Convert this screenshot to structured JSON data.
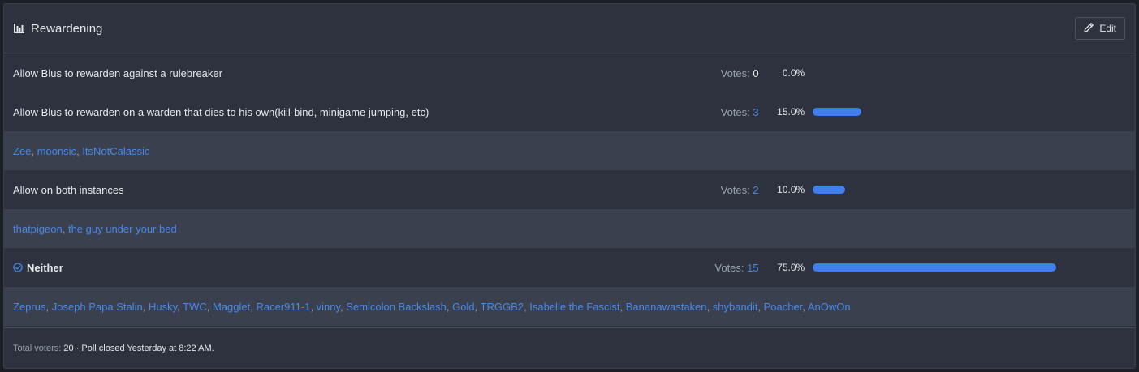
{
  "poll": {
    "title": "Rewardening",
    "edit_label": "Edit",
    "votes_label": "Votes:",
    "options": [
      {
        "label": "Allow Blus to rewarden against a rulebreaker",
        "votes": "0",
        "percent": "0.0%",
        "fraction": 0.0,
        "voters": [],
        "winner": false
      },
      {
        "label": "Allow Blus to rewarden on a warden that dies to his own(kill-bind, minigame jumping, etc)",
        "votes": "3",
        "percent": "15.0%",
        "fraction": 0.15,
        "voters": [
          "Zee",
          "moonsic",
          "ItsNotCalassic"
        ],
        "winner": false
      },
      {
        "label": "Allow on both instances",
        "votes": "2",
        "percent": "10.0%",
        "fraction": 0.1,
        "voters": [
          "thatpigeon",
          "the guy under your bed"
        ],
        "winner": false
      },
      {
        "label": "Neither",
        "votes": "15",
        "percent": "75.0%",
        "fraction": 0.75,
        "voters": [
          "Zeprus",
          "Joseph Papa Stalin",
          "Husky",
          "TWC",
          "Magglet",
          "Racer911-1",
          "vinny",
          "Semicolon Backslash",
          "Gold",
          "TRGGB2",
          "Isabelle the Fascist",
          "Bananawastaken",
          "shybandit",
          "Poacher",
          "AnOwOn"
        ],
        "winner": true
      }
    ],
    "footer": {
      "total_label": "Total voters:",
      "total_value": "20",
      "closed_text": "· Poll closed Yesterday at 8:22 AM."
    }
  },
  "colors": {
    "accent": "#3f7ff0",
    "link": "#4a88e8",
    "panel": "#2d323e",
    "voter_row": "#3a404d"
  }
}
